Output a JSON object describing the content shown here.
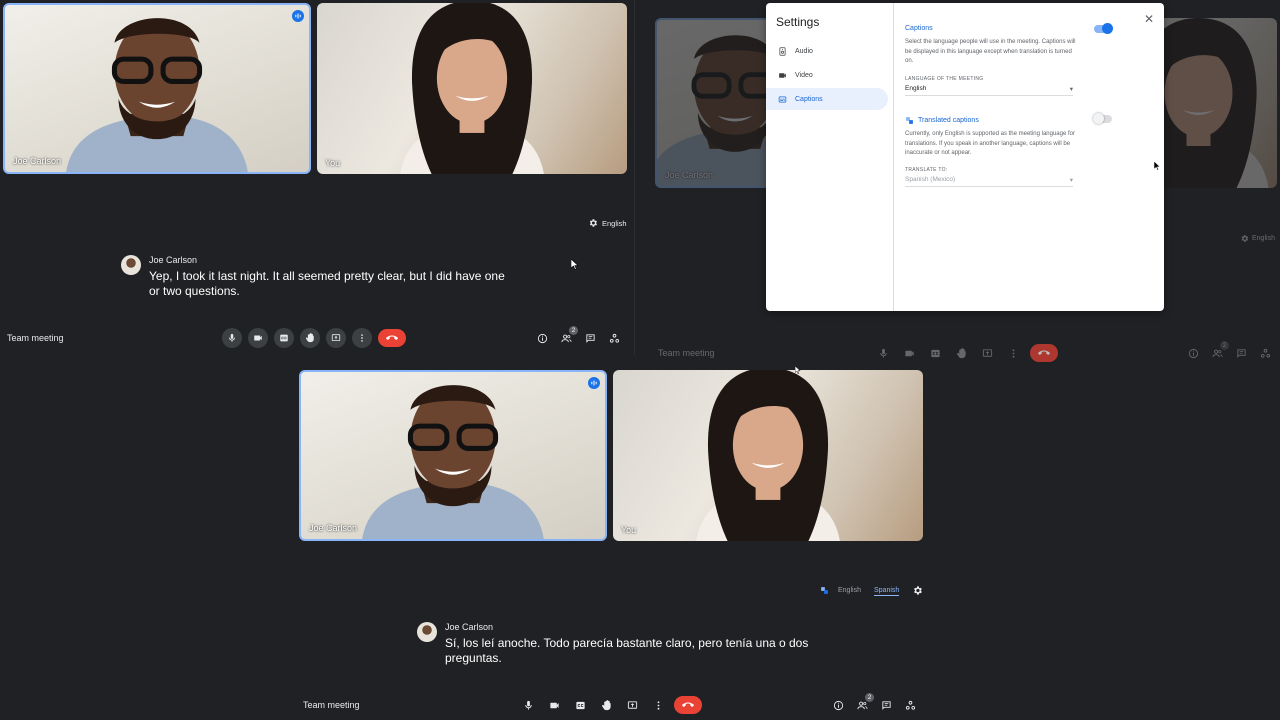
{
  "colors": {
    "background": "#202124",
    "accent_blue": "#1a73e8",
    "end_call_red": "#ea4335",
    "dialog_bg": "#ffffff"
  },
  "participants": {
    "joe": {
      "name": "Joe Carlson"
    },
    "you": {
      "name": "You"
    }
  },
  "top_left": {
    "caption_language": "English",
    "caption": {
      "speaker": "Joe Carlson",
      "text_line1": "Yep, I took it last night. It all seemed pretty clear, but I did have one",
      "text_line2": "or two questions."
    },
    "toolbar": {
      "meeting_title": "Team meeting",
      "people_count": "2"
    }
  },
  "top_right": {
    "caption_language": "English",
    "toolbar": {
      "meeting_title": "Team meeting",
      "people_count": "2"
    },
    "settings": {
      "title": "Settings",
      "close_icon": "close-icon",
      "nav": [
        {
          "label": "Audio",
          "icon": "speaker-icon"
        },
        {
          "label": "Video",
          "icon": "camera-icon"
        },
        {
          "label": "Captions",
          "icon": "captions-icon",
          "selected": true
        }
      ],
      "captions_section": {
        "heading": "Captions",
        "toggle_on": true,
        "description": "Select the language people will use in the meeting. Captions will be displayed in this language except when translation is turned on.",
        "language_label": "LANGUAGE OF THE MEETING",
        "language_value": "English"
      },
      "translated_section": {
        "heading": "Translated captions",
        "toggle_on": false,
        "description": "Currently, only English is supported as the meeting language for translations. If you speak in another language, captions will be inaccurate or not appear.",
        "translate_label": "TRANSLATE TO:",
        "translate_value": "Spanish (Mexico)"
      }
    }
  },
  "bottom": {
    "languages": {
      "source": "English",
      "target": "Spanish"
    },
    "caption": {
      "speaker": "Joe Carlson",
      "text_line1": "Sí, los leí anoche. Todo parecía bastante claro, pero tenía una o dos",
      "text_line2": "preguntas."
    },
    "toolbar": {
      "meeting_title": "Team meeting",
      "people_count": "2"
    }
  }
}
